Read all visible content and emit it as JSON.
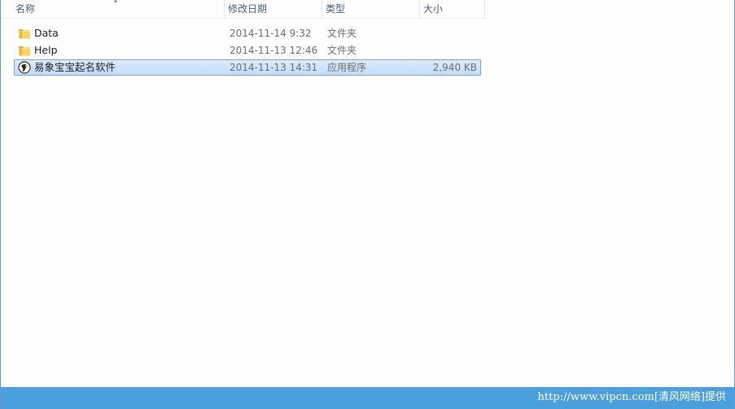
{
  "columns": {
    "name": "名称",
    "date": "修改日期",
    "type": "类型",
    "size": "大小"
  },
  "files": [
    {
      "name": "Data",
      "date": "2014-11-14 9:32",
      "type": "文件夹",
      "size": "",
      "icon": "folder-icon",
      "selected": false
    },
    {
      "name": "Help",
      "date": "2014-11-13 12:46",
      "type": "文件夹",
      "size": "",
      "icon": "folder-icon",
      "selected": false
    },
    {
      "name": "易象宝宝起名软件",
      "date": "2014-11-13 14:31",
      "type": "应用程序",
      "size": "2,940 KB",
      "icon": "app-icon",
      "selected": true
    }
  ],
  "watermark": "http://www.vipcn.com[清风网络]提供",
  "colors": {
    "selection_border": "#7da2ce",
    "selection_fill": "#cce4fc",
    "footer_bar": "#4a9fdc",
    "window_border": "#5b9bd5"
  }
}
